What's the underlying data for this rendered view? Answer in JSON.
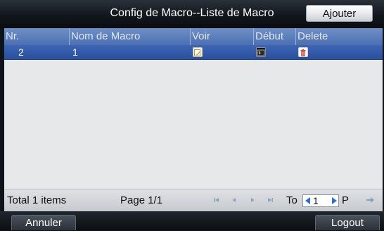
{
  "header": {
    "title": "Config de Macro--Liste de Macro",
    "add_label": "Ajouter"
  },
  "table": {
    "columns": [
      "Nr.",
      "Nom de Macro",
      "Voir",
      "Début",
      "Delete"
    ],
    "rows": [
      {
        "nr": "2",
        "name": "1",
        "view_icon": "edit-icon",
        "start_icon": "terminal-icon",
        "delete_icon": "trash-icon"
      }
    ]
  },
  "footer": {
    "total": "Total 1 items",
    "page": "Page 1/1",
    "to_label": "To",
    "page_input": "1",
    "go_label": "P"
  },
  "bottom": {
    "cancel_label": "Annuler",
    "logout_label": "Logout"
  },
  "colors": {
    "header_blue": "#5a7bbd",
    "selected_row_blue": "#3059a6",
    "delete_red": "#d23b2c"
  }
}
